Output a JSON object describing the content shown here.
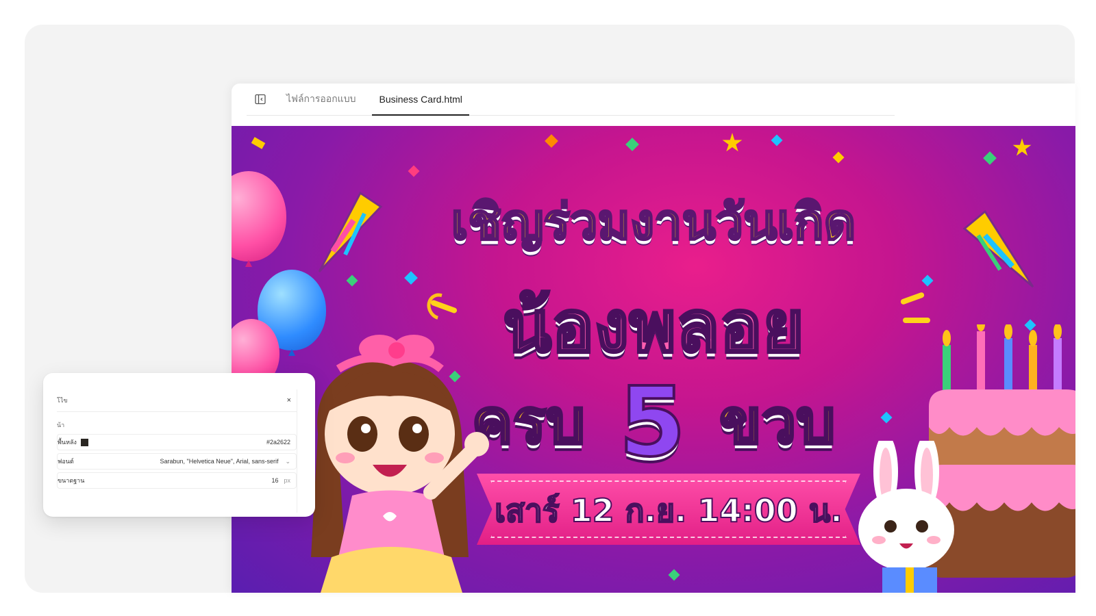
{
  "tabs": {
    "design_files_label": "ไฟล์การออกแบบ",
    "active_file_label": "Business Card.html"
  },
  "canvas": {
    "title_line_1": "เชิญร่วมงานวันเกิด",
    "title_line_2": "น้องพลอย",
    "title_line_3_prefix": "ครบ",
    "title_line_3_number": "5",
    "title_line_3_suffix": "ขวบ",
    "date_time": "เสาร์ 12 ก.ย. 14:00 น."
  },
  "properties_panel": {
    "title": "โไข",
    "close_glyph": "×",
    "section_label": "น้า",
    "rows": [
      {
        "label": "พื้นหลัง",
        "value": "#2a2622",
        "swatch_color": "#2a2622"
      },
      {
        "label": "ฟอนต์",
        "value": "Sarabun, \"Helvetica Neue\", Arial, sans-serif",
        "chevron": "⌄"
      },
      {
        "label": "ขนาดฐาน",
        "value": "16",
        "unit": "px"
      }
    ]
  },
  "colors": {
    "banner_magenta": "#c5158f",
    "banner_purple": "#5a1eb0",
    "title_yellow": "#ffd21a",
    "title_pink": "#ff5fb0",
    "number_purple": "#8f47f0"
  },
  "icons": {
    "sidebar_toggle": "sidebar-toggle-icon"
  }
}
